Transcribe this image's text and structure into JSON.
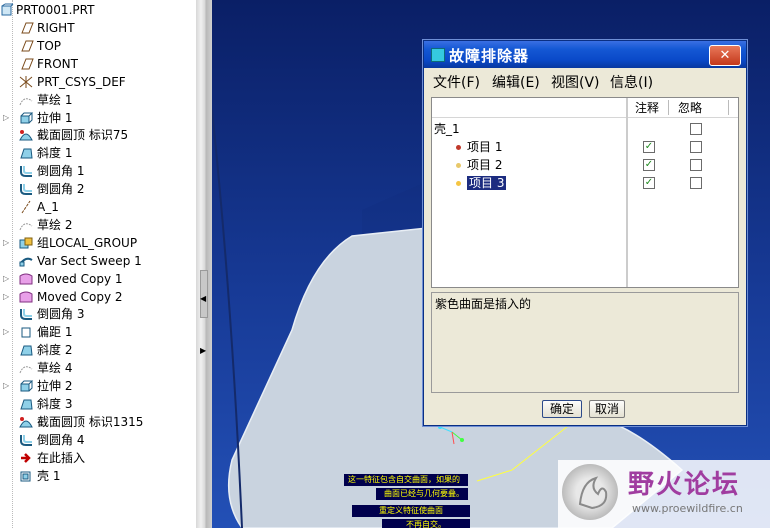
{
  "tree": {
    "root": "PRT0001.PRT",
    "items": [
      {
        "label": "RIGHT",
        "icon": "datum-plane-icon",
        "expander": false
      },
      {
        "label": "TOP",
        "icon": "datum-plane-icon",
        "expander": false
      },
      {
        "label": "FRONT",
        "icon": "datum-plane-icon",
        "expander": false
      },
      {
        "label": "PRT_CSYS_DEF",
        "icon": "coordinate-system-icon",
        "expander": false
      },
      {
        "label": "草绘 1",
        "icon": "sketch-icon",
        "expander": false
      },
      {
        "label": "拉伸 1",
        "icon": "extrude-icon",
        "expander": true
      },
      {
        "label": "截面圆顶 标识75",
        "icon": "section-dome-icon",
        "expander": false
      },
      {
        "label": "斜度 1",
        "icon": "draft-icon",
        "expander": false
      },
      {
        "label": "倒圆角 1",
        "icon": "round-icon",
        "expander": false
      },
      {
        "label": "倒圆角 2",
        "icon": "round-icon",
        "expander": false
      },
      {
        "label": "A_1",
        "icon": "datum-axis-icon",
        "expander": false
      },
      {
        "label": "草绘 2",
        "icon": "sketch-icon",
        "expander": false
      },
      {
        "label": "组LOCAL_GROUP",
        "icon": "group-icon",
        "expander": true
      },
      {
        "label": "Var Sect Sweep 1",
        "icon": "var-sect-sweep-icon",
        "expander": false
      },
      {
        "label": "Moved Copy 1",
        "icon": "moved-copy-icon",
        "expander": true
      },
      {
        "label": "Moved Copy 2",
        "icon": "moved-copy-icon",
        "expander": true
      },
      {
        "label": "倒圆角 3",
        "icon": "round-icon",
        "expander": false
      },
      {
        "label": "偏距 1",
        "icon": "offset-icon",
        "expander": true
      },
      {
        "label": "斜度 2",
        "icon": "draft-icon",
        "expander": false
      },
      {
        "label": "草绘 4",
        "icon": "sketch-icon",
        "expander": false
      },
      {
        "label": "拉伸 2",
        "icon": "extrude-icon",
        "expander": true
      },
      {
        "label": "斜度 3",
        "icon": "draft-icon",
        "expander": false
      },
      {
        "label": "截面圆顶 标识1315",
        "icon": "section-dome-icon",
        "expander": false
      },
      {
        "label": "倒圆角 4",
        "icon": "round-icon",
        "expander": false
      },
      {
        "label": "在此插入",
        "icon": "insert-here-arrow-icon",
        "expander": false
      },
      {
        "label": "壳 1",
        "icon": "shell-icon",
        "expander": false
      }
    ]
  },
  "dialog": {
    "title": "故障排除器",
    "close_label": "✕",
    "menus": [
      "文件(F)",
      "编辑(E)",
      "视图(V)",
      "信息(I)"
    ],
    "columns": {
      "note": "注释",
      "ignore": "忽略"
    },
    "group_label": "壳_1",
    "rows": [
      {
        "label": "项目 1",
        "bullet_color": "#c0392b",
        "note": true,
        "ignore": false,
        "selected": false
      },
      {
        "label": "项目 2",
        "bullet_color": "#e8c86a",
        "note": true,
        "ignore": false,
        "selected": false
      },
      {
        "label": "项目 3",
        "bullet_color": "#f5c542",
        "note": true,
        "ignore": false,
        "selected": true
      }
    ],
    "description": "紫色曲面是插入的",
    "ok_label": "确定",
    "cancel_label": "取消"
  },
  "viewport": {
    "notes": [
      "这一特征包含自交曲面，如果的",
      "曲面已经与几何要叠。",
      "重定义特征使曲面",
      "不再自交。"
    ]
  },
  "watermark": {
    "title": "野火论坛",
    "url": "www.proewildfire.cn"
  },
  "colors": {
    "viewport_bg": "#173a96",
    "selection": "#1c2c80",
    "titlebar": "#0a49c9",
    "note_text": "#ffff00",
    "watermark": "#a03da0"
  }
}
